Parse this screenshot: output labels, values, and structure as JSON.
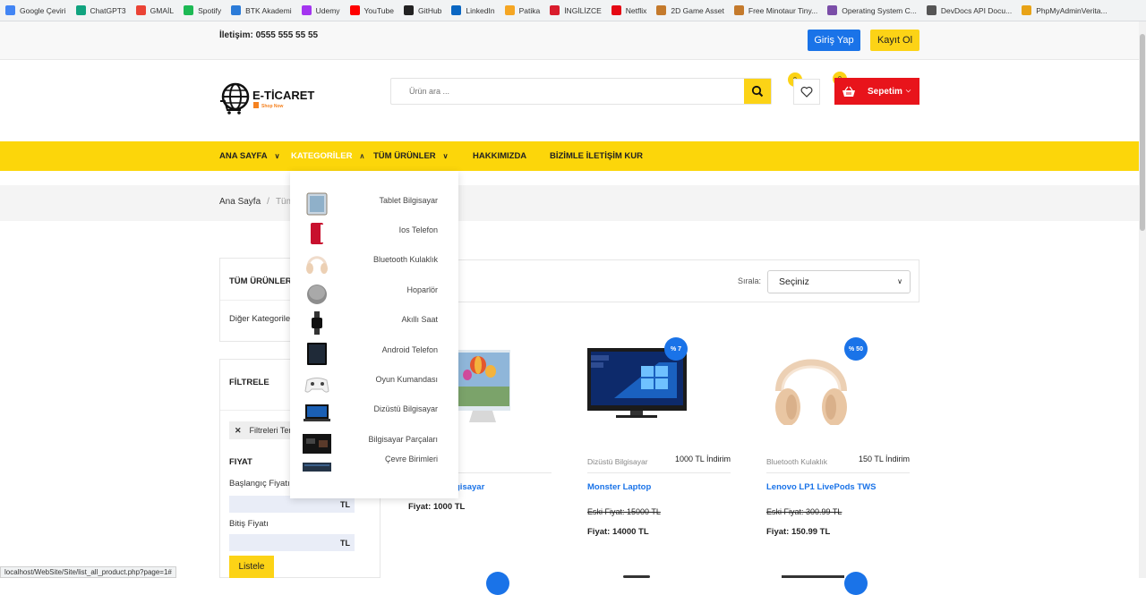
{
  "bookmarks": [
    {
      "label": "Google Çeviri",
      "color": "#4285f4"
    },
    {
      "label": "ChatGPT3",
      "color": "#10a37f"
    },
    {
      "label": "GMAİL",
      "color": "#ea4335"
    },
    {
      "label": "Spotify",
      "color": "#1db954"
    },
    {
      "label": "BTK Akademi",
      "color": "#2b7bd8"
    },
    {
      "label": "Udemy",
      "color": "#a435f0"
    },
    {
      "label": "YouTube",
      "color": "#ff0000"
    },
    {
      "label": "GitHub",
      "color": "#222222"
    },
    {
      "label": "LinkedIn",
      "color": "#0a66c2"
    },
    {
      "label": "Patika",
      "color": "#f5a623"
    },
    {
      "label": "İNGİLİZCE",
      "color": "#d91c2c"
    },
    {
      "label": "Netflix",
      "color": "#e50914"
    },
    {
      "label": "2D Game Asset",
      "color": "#c47a2c"
    },
    {
      "label": "Free Minotaur Tiny...",
      "color": "#c47a2c"
    },
    {
      "label": "Operating System C...",
      "color": "#7b4ea8"
    },
    {
      "label": "DevDocs API Docu...",
      "color": "#555555"
    },
    {
      "label": "PhpMyAdminVerita...",
      "color": "#e8a317"
    }
  ],
  "topbar": {
    "contact": "İletişim: 0555 555 55 55",
    "login": "Giriş Yap",
    "register": "Kayıt Ol"
  },
  "header": {
    "logo_text": "E-TİCARET",
    "logo_sub": "Shop Now",
    "search_placeholder": "Ürün ara ...",
    "wishlist_count": "0",
    "cart_count": "0",
    "cart_label": "Sepetim"
  },
  "nav": {
    "home": "ANA SAYFA",
    "categories": "KATEGORİLER",
    "all_products": "TÜM ÜRÜNLER",
    "about": "HAKKIMIZDA",
    "contact": "BİZİMLE İLETİŞİM KUR"
  },
  "breadcrumb": {
    "home": "Ana Sayfa",
    "sep": "/",
    "current": "Tüm"
  },
  "sidebar": {
    "all_products": "TÜM ÜRÜNLER",
    "other_categories": "Diğer Kategoriler",
    "filter_title": "FİLTRELE",
    "filter_chip": "Filtreleri Temizle",
    "price_title": "FIYAT",
    "start_price": "Başlangıç Fiyatı",
    "end_price": "Bitiş Fiyatı",
    "currency": "TL",
    "list_button": "Listele"
  },
  "sort": {
    "label": "Sırala:",
    "selected": "Seçiniz"
  },
  "dropdown": [
    {
      "label": "Tablet Bilgisayar",
      "icon": "tablet"
    },
    {
      "label": "Ios Telefon",
      "icon": "phone-red"
    },
    {
      "label": "Bluetooth Kulaklık",
      "icon": "headphones"
    },
    {
      "label": "Hoparlör",
      "icon": "speaker"
    },
    {
      "label": "Akıllı Saat",
      "icon": "watch"
    },
    {
      "label": "Android Telefon",
      "icon": "phone-black"
    },
    {
      "label": "Oyun Kumandası",
      "icon": "gamepad"
    },
    {
      "label": "Dizüstü Bilgisayar",
      "icon": "laptop"
    },
    {
      "label": "Bilgisayar Parçaları",
      "icon": "pc-parts"
    },
    {
      "label": "Çevre Birimleri",
      "icon": "keyboard"
    }
  ],
  "products": [
    {
      "category": "ayar",
      "discount": "",
      "name": "gisayar",
      "old_price": "",
      "price": "Fiyat: 1000 TL",
      "badge": "",
      "image": "monitor-balloon"
    },
    {
      "category": "Dizüstü Bilgisayar",
      "discount": "1000 TL İndirim",
      "name": "Monster Laptop",
      "old_price": "Eski Fiyat: 15000 TL",
      "price": "Fiyat: 14000 TL",
      "badge": "% 7",
      "image": "monitor-windows"
    },
    {
      "category": "Bluetooth Kulaklık",
      "discount": "150 TL İndirim",
      "name": "Lenovo LP1 LivePods TWS",
      "old_price": "Eski Fiyat: 300.99 TL",
      "price": "Fiyat: 150.99 TL",
      "badge": "% 50",
      "image": "headphones"
    }
  ],
  "status_url": "localhost/WebSite/Site/list_all_product.php?page=1#",
  "colors": {
    "accent_yellow": "#fcd60a",
    "blue": "#1a73e8",
    "red": "#e8141b"
  }
}
